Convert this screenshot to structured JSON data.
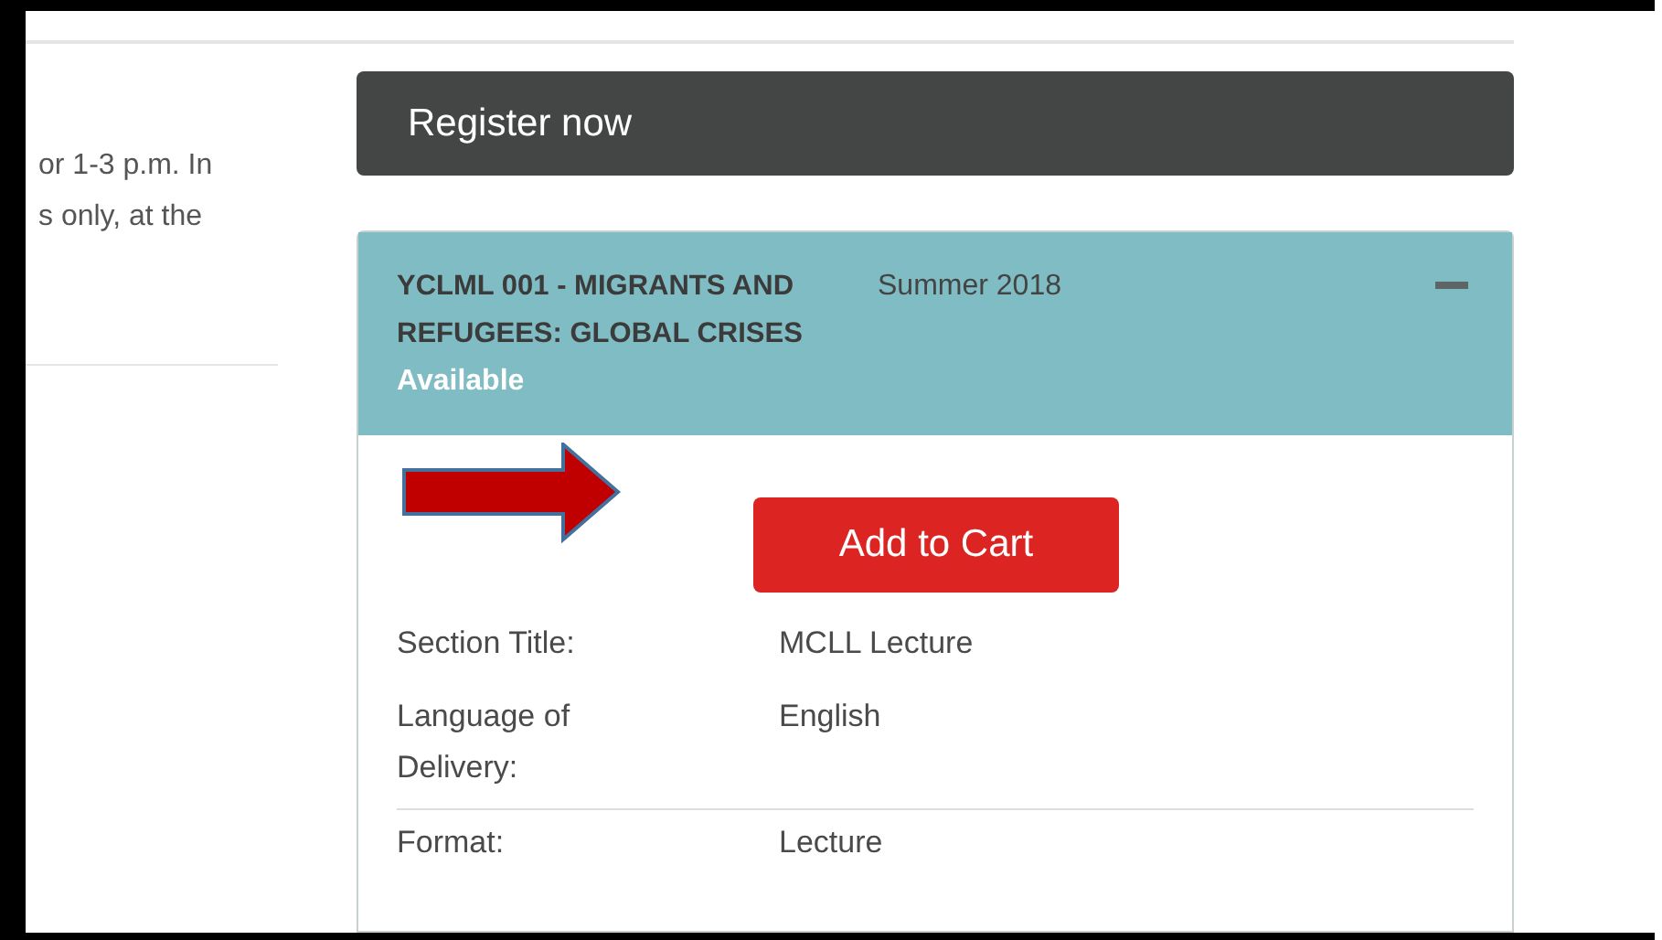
{
  "intro_text": {
    "lines": [
      "or 1-3 p.m. In",
      "s only, at the"
    ]
  },
  "register_header": {
    "title": "Register now"
  },
  "course": {
    "title": "YCLML 001 - MIGRANTS AND REFUGEES: GLOBAL CRISES",
    "status": "Available",
    "term": "Summer 2018",
    "expanded": true,
    "add_button": "Add to Cart",
    "details": [
      {
        "label": "Section Title:",
        "value": "MCLL Lecture"
      },
      {
        "label": "Language of Delivery:",
        "value": "English"
      },
      {
        "label": "Format:",
        "value": "Lecture"
      }
    ]
  }
}
